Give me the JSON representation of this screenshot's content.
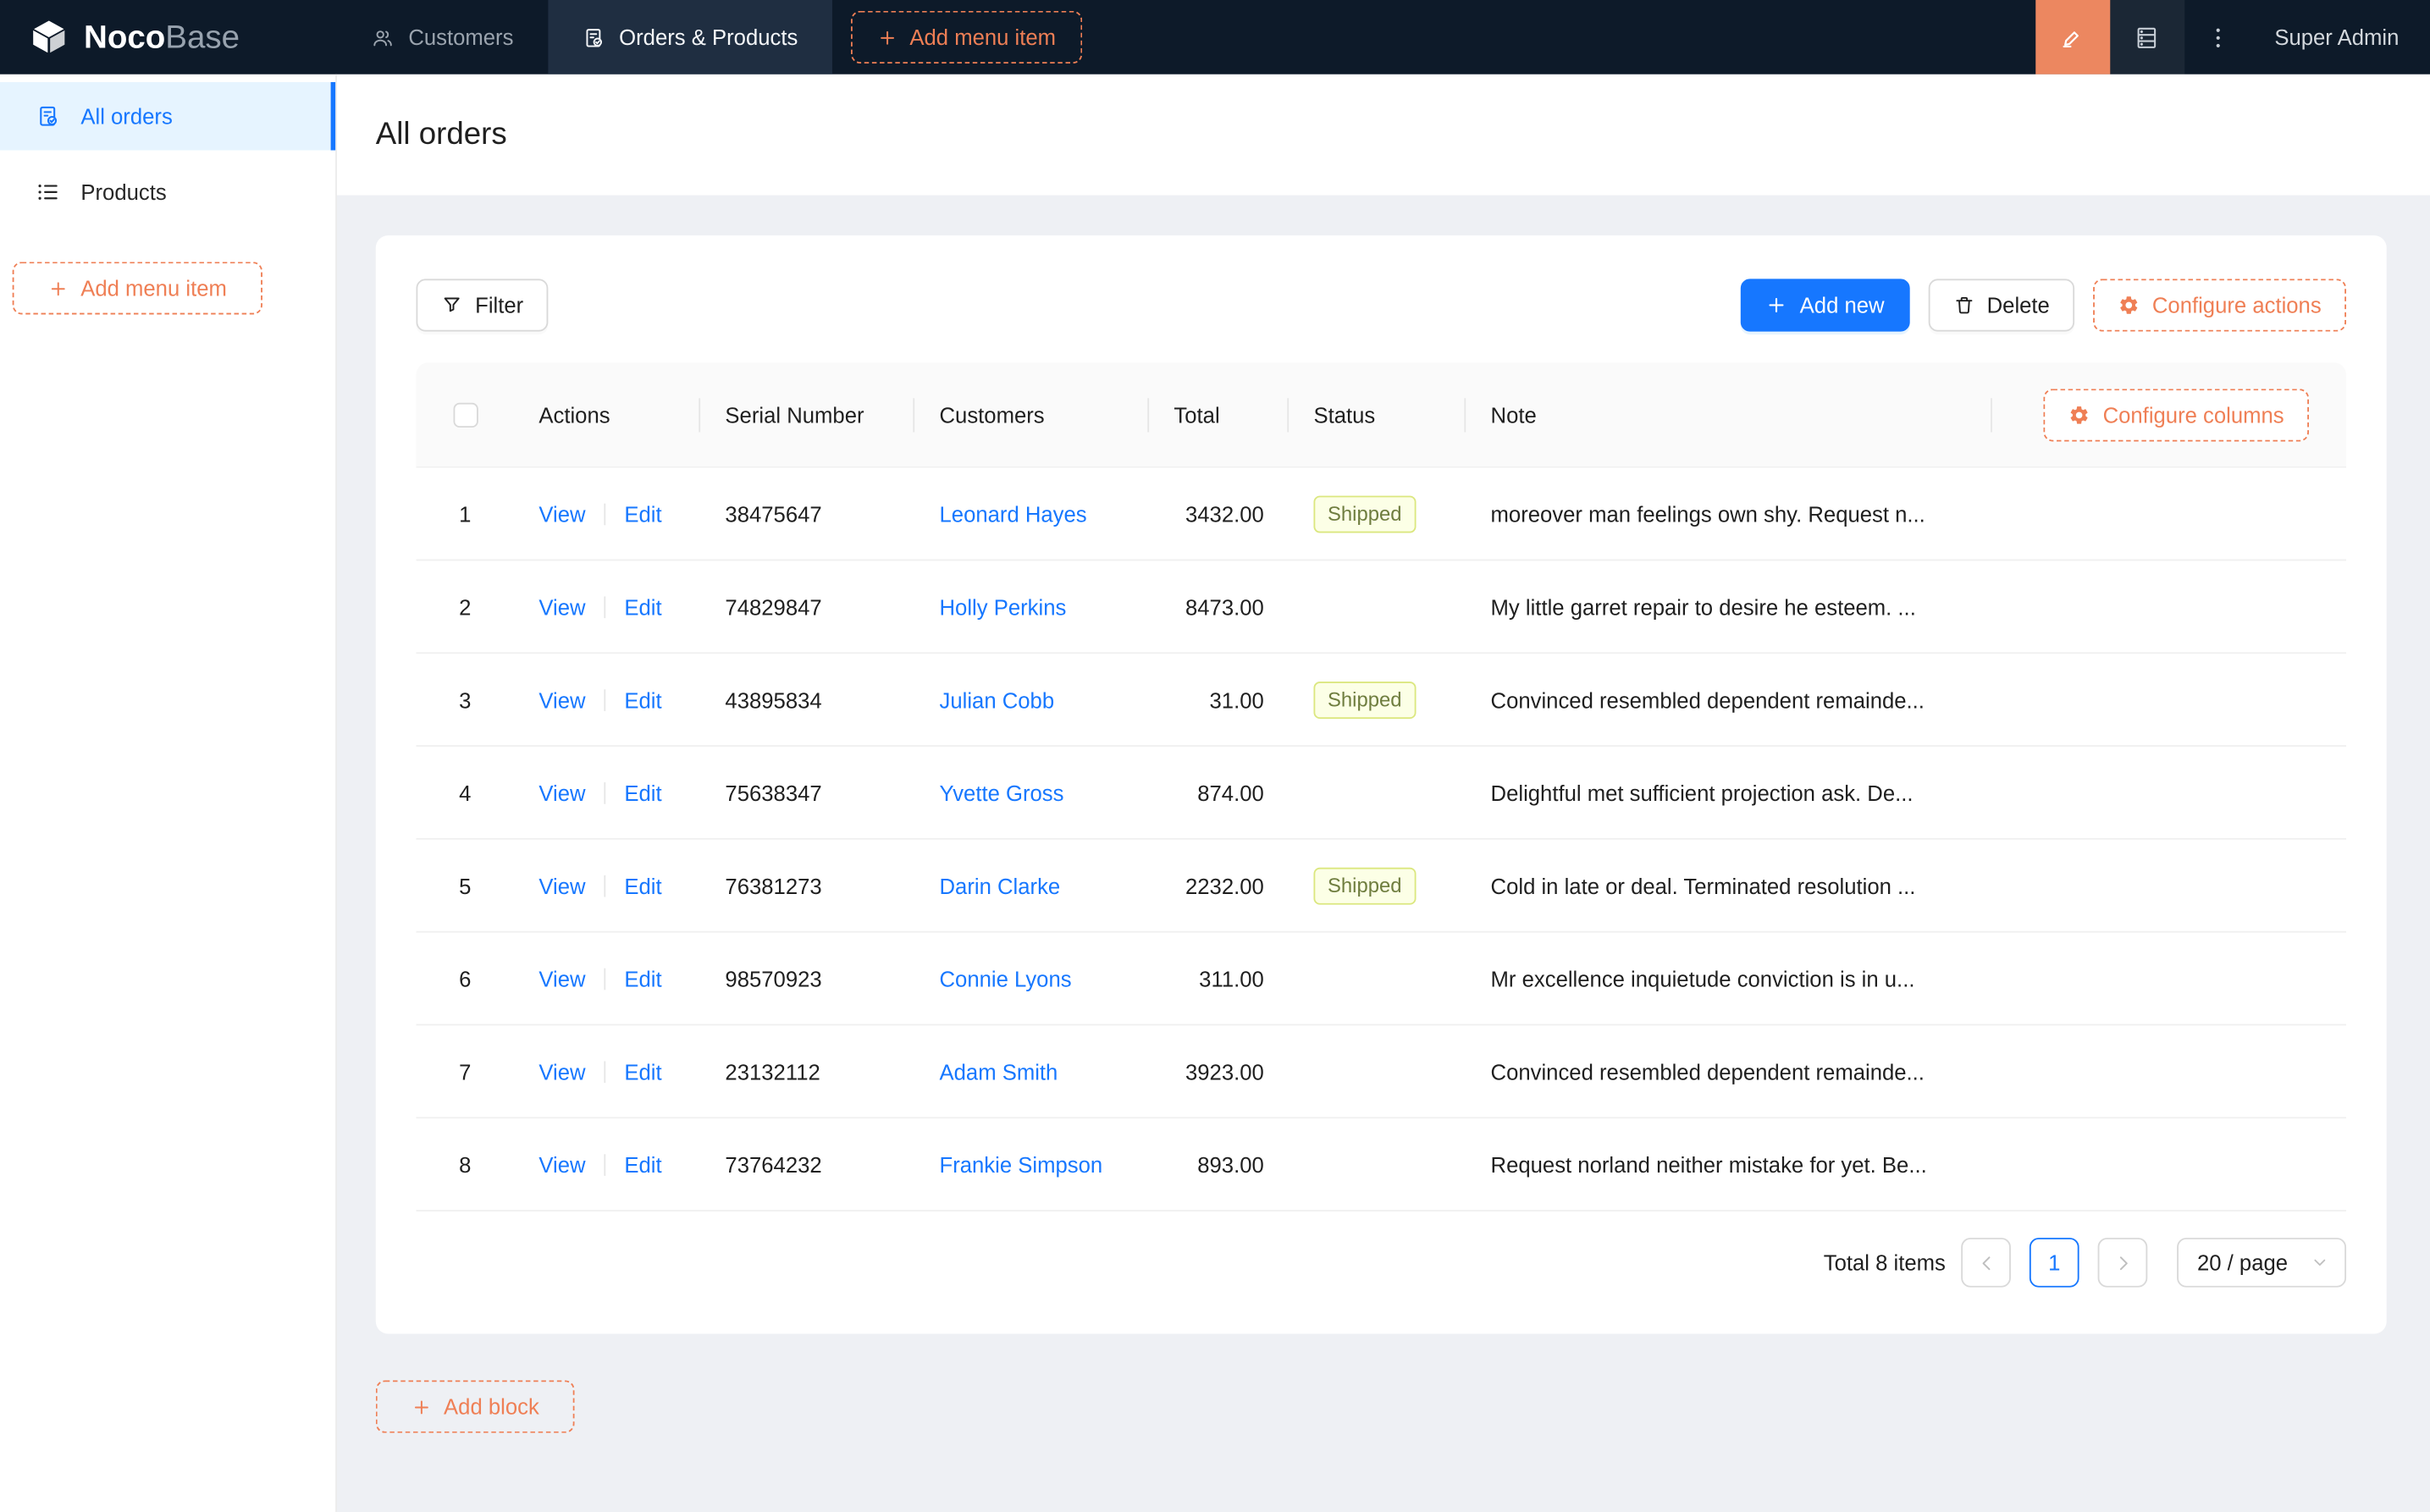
{
  "brand": {
    "name_bold": "Noco",
    "name_light": "Base"
  },
  "navbar": {
    "tabs": [
      {
        "label": "Customers",
        "active": false
      },
      {
        "label": "Orders & Products",
        "active": true
      }
    ],
    "add_menu_item_label": "Add menu item",
    "user": "Super Admin"
  },
  "sidebar": {
    "items": [
      {
        "label": "All orders",
        "active": true
      },
      {
        "label": "Products",
        "active": false
      }
    ],
    "add_menu_item_label": "Add menu item"
  },
  "page": {
    "title": "All orders"
  },
  "toolbar": {
    "filter": "Filter",
    "add_new": "Add new",
    "delete": "Delete",
    "configure_actions": "Configure actions"
  },
  "table": {
    "columns": [
      "Actions",
      "Serial Number",
      "Customers",
      "Total",
      "Status",
      "Note"
    ],
    "configure_columns": "Configure columns",
    "action_labels": {
      "view": "View",
      "edit": "Edit"
    },
    "rows": [
      {
        "index": 1,
        "serial": "38475647",
        "customer": "Leonard Hayes",
        "total": "3432.00",
        "status": "Shipped",
        "note": "moreover man feelings own shy. Request n..."
      },
      {
        "index": 2,
        "serial": "74829847",
        "customer": "Holly Perkins",
        "total": "8473.00",
        "status": "",
        "note": "My little garret repair to desire he esteem. ..."
      },
      {
        "index": 3,
        "serial": "43895834",
        "customer": "Julian Cobb",
        "total": "31.00",
        "status": "Shipped",
        "note": "Convinced resembled dependent remainde..."
      },
      {
        "index": 4,
        "serial": "75638347",
        "customer": "Yvette Gross",
        "total": "874.00",
        "status": "",
        "note": "Delightful met sufficient projection ask. De..."
      },
      {
        "index": 5,
        "serial": "76381273",
        "customer": "Darin Clarke",
        "total": "2232.00",
        "status": "Shipped",
        "note": "Cold in late or deal. Terminated resolution ..."
      },
      {
        "index": 6,
        "serial": "98570923",
        "customer": "Connie Lyons",
        "total": "311.00",
        "status": "",
        "note": "Mr excellence inquietude conviction is in u..."
      },
      {
        "index": 7,
        "serial": "23132112",
        "customer": "Adam Smith",
        "total": "3923.00",
        "status": "",
        "note": "Convinced resembled dependent remainde..."
      },
      {
        "index": 8,
        "serial": "73764232",
        "customer": "Frankie Simpson",
        "total": "893.00",
        "status": "",
        "note": "Request norland neither mistake for yet. Be..."
      }
    ]
  },
  "pagination": {
    "total_text": "Total 8 items",
    "current_page": "1",
    "page_size": "20 / page"
  },
  "footer": {
    "add_block_label": "Add block"
  },
  "colors": {
    "accent_blue": "#1677ff",
    "accent_orange": "#ef7f55",
    "navbar_bg": "#0d1a29",
    "navbar_active_tab": "#1f2e41",
    "sidebar_selected_bg": "#e6f4ff",
    "content_bg": "#eef0f4",
    "table_header_bg": "#fafafa",
    "status_tag_bg": "#fcffe6",
    "status_tag_border": "#dbe77f",
    "status_tag_text": "#6f7d3f"
  }
}
